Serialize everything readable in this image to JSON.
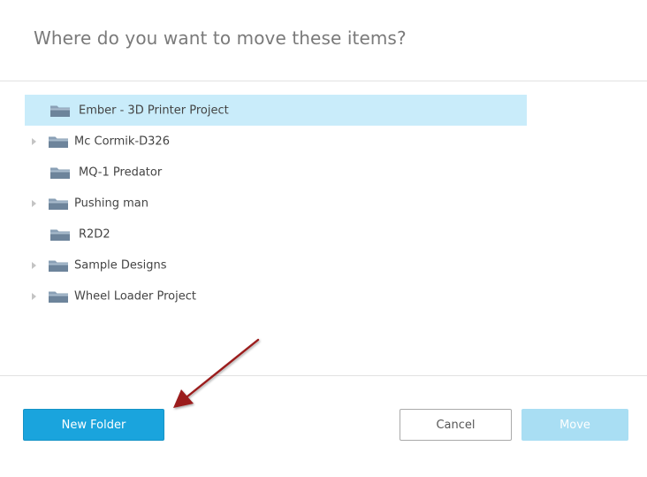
{
  "dialog": {
    "title": "Where do you want to move these items?"
  },
  "tree": {
    "items": [
      {
        "label": "Ember - 3D Printer Project",
        "expandable": false,
        "selected": true
      },
      {
        "label": "Mc Cormik-D326",
        "expandable": true,
        "selected": false
      },
      {
        "label": "MQ-1 Predator",
        "expandable": false,
        "selected": false
      },
      {
        "label": "Pushing man",
        "expandable": true,
        "selected": false
      },
      {
        "label": "R2D2",
        "expandable": false,
        "selected": false
      },
      {
        "label": "Sample Designs",
        "expandable": true,
        "selected": false
      },
      {
        "label": "Wheel Loader Project",
        "expandable": true,
        "selected": false
      }
    ]
  },
  "footer": {
    "new_folder_label": "New Folder",
    "cancel_label": "Cancel",
    "move_label": "Move"
  },
  "icons": {
    "folder": "folder-icon",
    "expander": "chevron-right-icon",
    "annotation": "arrow-annotation-icon"
  },
  "colors": {
    "accent": "#1aa4dd",
    "selected_row": "#c9ecfa",
    "move_disabled": "#a9def3",
    "annotation_arrow": "#9b1c1c"
  }
}
